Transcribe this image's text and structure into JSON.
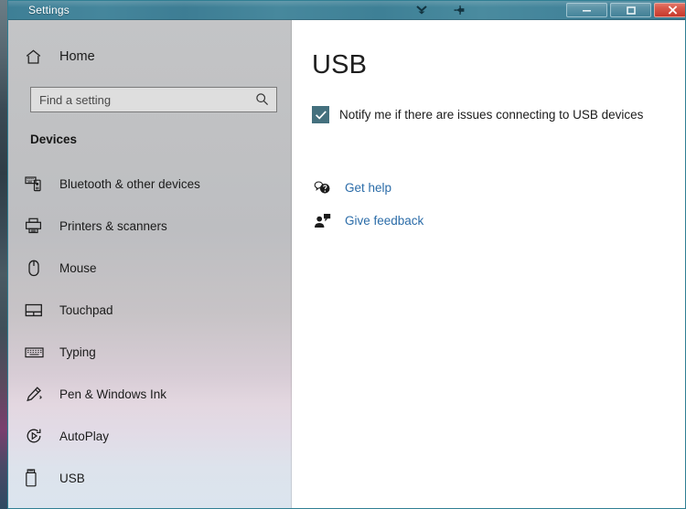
{
  "window": {
    "title": "Settings",
    "titlebar_color": "#3e7f96",
    "controls": {
      "collapse_icon": "double-chevron-down-icon",
      "pin_icon": "pin-icon",
      "minimize_label": "",
      "maximize_label": "",
      "close_label": "",
      "close_color": "#c8392c"
    }
  },
  "sidebar": {
    "home": {
      "label": "Home",
      "icon": "home-icon"
    },
    "search": {
      "placeholder": "Find a setting",
      "value": "",
      "icon": "search-icon"
    },
    "section_header": "Devices",
    "items": [
      {
        "label": "Bluetooth & other devices",
        "icon": "bluetooth-devices-icon",
        "selected": false
      },
      {
        "label": "Printers & scanners",
        "icon": "printer-icon",
        "selected": false
      },
      {
        "label": "Mouse",
        "icon": "mouse-icon",
        "selected": false
      },
      {
        "label": "Touchpad",
        "icon": "touchpad-icon",
        "selected": false
      },
      {
        "label": "Typing",
        "icon": "keyboard-icon",
        "selected": false
      },
      {
        "label": "Pen & Windows Ink",
        "icon": "pen-icon",
        "selected": false
      },
      {
        "label": "AutoPlay",
        "icon": "autoplay-icon",
        "selected": false
      },
      {
        "label": "USB",
        "icon": "usb-drive-icon",
        "selected": true
      }
    ]
  },
  "main": {
    "title": "USB",
    "checkbox": {
      "label": "Notify me if there are issues connecting to USB devices",
      "checked": true,
      "accent_color": "#44707e"
    },
    "links": [
      {
        "label": "Get help",
        "icon": "help-bubble-icon"
      },
      {
        "label": "Give feedback",
        "icon": "feedback-person-icon"
      }
    ],
    "link_color": "#2b6ca8"
  }
}
